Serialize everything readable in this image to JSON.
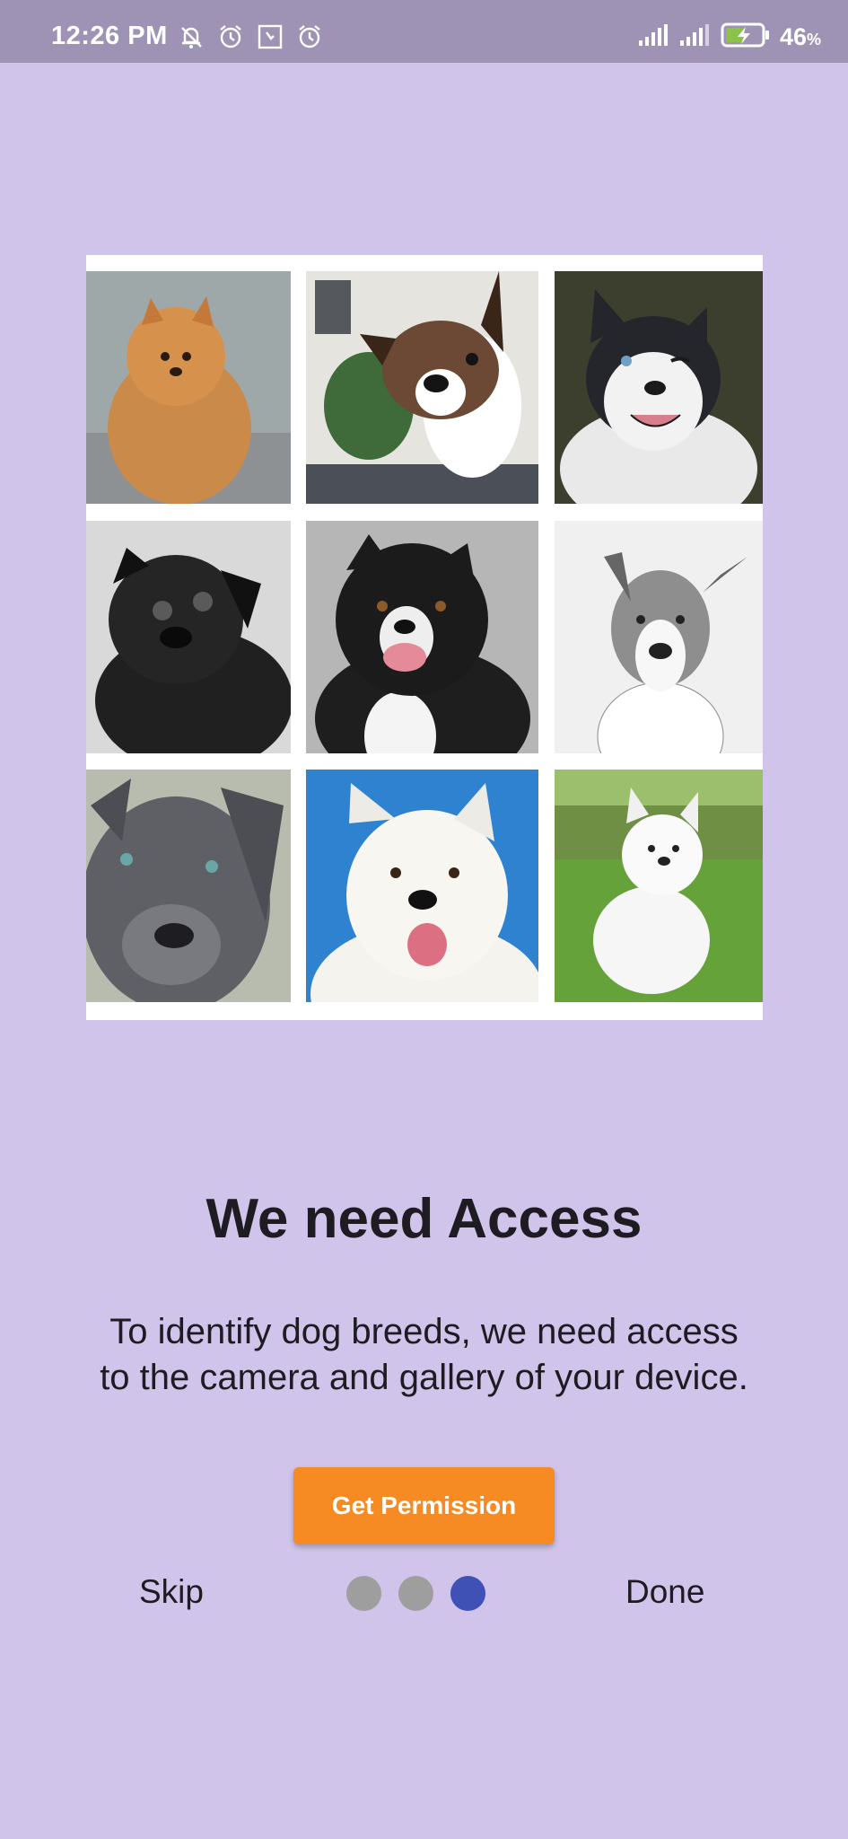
{
  "status_bar": {
    "time": "12:26 PM",
    "battery_percent": "46",
    "battery_unit": "%",
    "icons": [
      "notifications-off-icon",
      "alarm-icon",
      "app-notification-icon",
      "alarm-icon",
      "signal-icon",
      "signal-icon",
      "battery-charging-icon"
    ]
  },
  "grid": {
    "images": [
      {
        "name": "pomeranian-photo"
      },
      {
        "name": "french-bulldog-photo"
      },
      {
        "name": "husky-photo"
      },
      {
        "name": "pug-photo"
      },
      {
        "name": "border-collie-photo"
      },
      {
        "name": "pitbull-photo"
      },
      {
        "name": "grey-pitbull-photo"
      },
      {
        "name": "white-shepherd-photo"
      },
      {
        "name": "samoyed-photo"
      }
    ]
  },
  "onboarding": {
    "title": "We need Access",
    "description": "To identify dog breeds, we need access to the camera and gallery of your device.",
    "button_label": "Get Permission",
    "skip_label": "Skip",
    "done_label": "Done",
    "page_count": 3,
    "active_page": 3
  },
  "colors": {
    "background": "#d0c4ea",
    "status_bar": "#9e93b5",
    "button": "#f68b24",
    "dot_active": "#3f51b5",
    "dot_inactive": "#9e9e9e"
  }
}
